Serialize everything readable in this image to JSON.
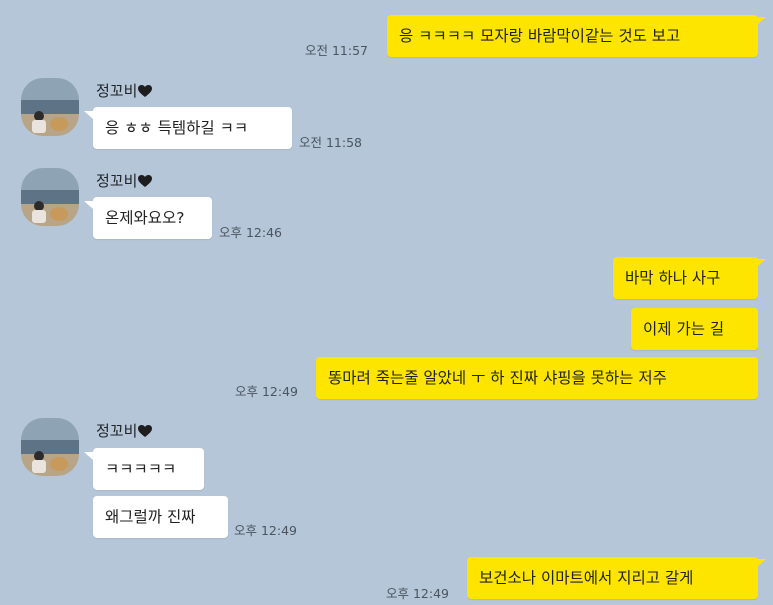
{
  "chat": {
    "sender_name": "정꼬비",
    "messages": [
      {
        "text": "응 ㅋㅋㅋㅋ 모자랑 바람막이같는 것도 보고",
        "time": "오전 11:57"
      },
      {
        "text": "응 ㅎㅎ 득템하길 ㅋㅋ",
        "time": "오전 11:58"
      },
      {
        "text": "온제와요오?",
        "time": "오후 12:46"
      },
      {
        "text": "바막 하나 사구"
      },
      {
        "text": "이제 가는 길"
      },
      {
        "text": "똥마려 죽는줄 알았네 ㅜ 하 진짜 샤핑을 못하는 저주",
        "time": "오후 12:49"
      },
      {
        "text": "ㅋㅋㅋㅋㅋ"
      },
      {
        "text": "왜그럴까 진짜",
        "time": "오후 12:49"
      },
      {
        "text": "보건소나 이마트에서 지리고 갈게",
        "time": "오후 12:49"
      }
    ]
  },
  "colors": {
    "background": "#b5c6d8",
    "my_bubble": "#fee500",
    "other_bubble": "#ffffff"
  },
  "icons": {
    "heart": "heart-icon",
    "avatar": "profile-photo"
  }
}
